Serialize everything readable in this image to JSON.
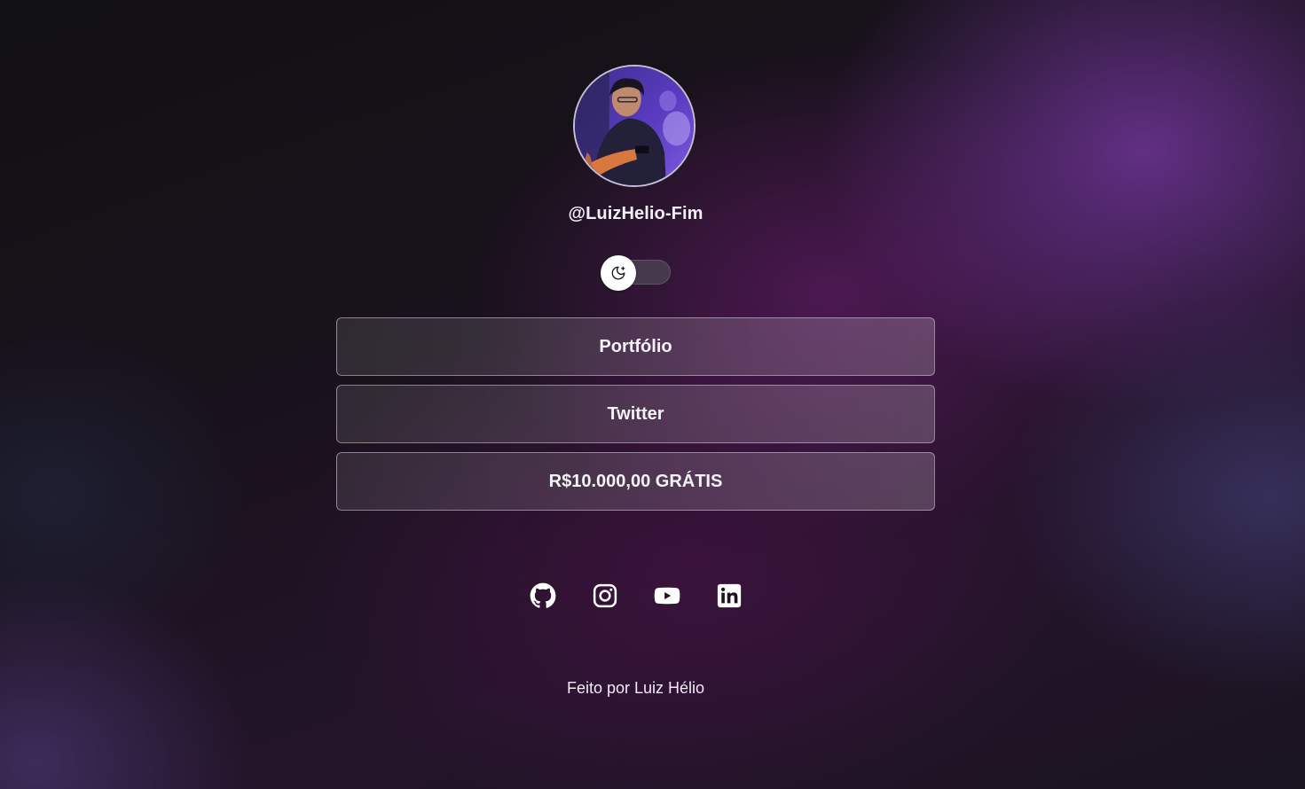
{
  "profile": {
    "handle": "@LuizHelio-Fim",
    "avatar": "profile-photo"
  },
  "theme_toggle": {
    "icon": "moon-sparkle-icon",
    "state": "dark"
  },
  "links": [
    {
      "label": "Portfólio"
    },
    {
      "label": "Twitter"
    },
    {
      "label": "R$10.000,00 GRÁTIS"
    }
  ],
  "socials": [
    {
      "icon": "github-icon"
    },
    {
      "icon": "instagram-icon"
    },
    {
      "icon": "youtube-icon"
    },
    {
      "icon": "linkedin-icon"
    }
  ],
  "footer": {
    "text": "Feito por Luiz Hélio"
  },
  "colors": {
    "background": "#131116",
    "accent_purple": "#6e3496",
    "text": "#f4f0f7",
    "button_border": "#d7c8e1"
  }
}
